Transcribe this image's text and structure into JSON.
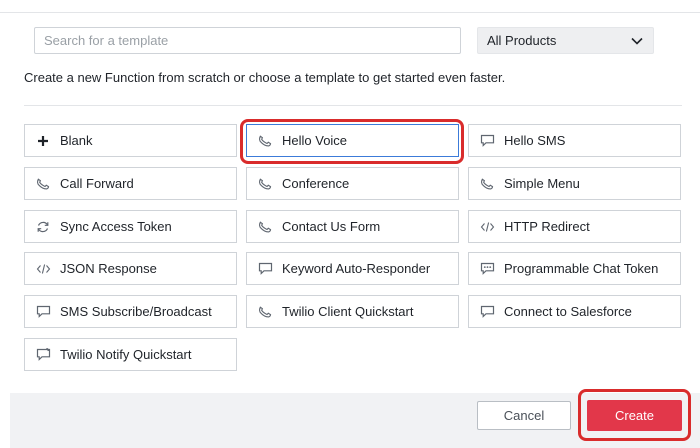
{
  "colors": {
    "accent": "#e2374a",
    "selection": "#3c7bd9",
    "highlight": "#d92c2c"
  },
  "search": {
    "placeholder": "Search for a template",
    "value": ""
  },
  "product_filter": {
    "selected": "All Products",
    "icon": "chevron-down-icon"
  },
  "intro_text": "Create a new Function from scratch or choose a template to get started even faster.",
  "templates": [
    {
      "label": "Blank",
      "icon": "plus-icon",
      "selected": false
    },
    {
      "label": "Hello Voice",
      "icon": "phone-icon",
      "selected": true
    },
    {
      "label": "Hello SMS",
      "icon": "message-icon",
      "selected": false
    },
    {
      "label": "Call Forward",
      "icon": "phone-icon",
      "selected": false
    },
    {
      "label": "Conference",
      "icon": "phone-icon",
      "selected": false
    },
    {
      "label": "Simple Menu",
      "icon": "phone-icon",
      "selected": false
    },
    {
      "label": "Sync Access Token",
      "icon": "sync-icon",
      "selected": false
    },
    {
      "label": "Contact Us Form",
      "icon": "phone-icon",
      "selected": false
    },
    {
      "label": "HTTP Redirect",
      "icon": "code-icon",
      "selected": false
    },
    {
      "label": "JSON Response",
      "icon": "code-icon",
      "selected": false
    },
    {
      "label": "Keyword Auto-Responder",
      "icon": "message-icon",
      "selected": false
    },
    {
      "label": "Programmable Chat Token",
      "icon": "chat-icon",
      "selected": false
    },
    {
      "label": "SMS Subscribe/Broadcast",
      "icon": "message-icon",
      "selected": false
    },
    {
      "label": "Twilio Client Quickstart",
      "icon": "phone-icon",
      "selected": false
    },
    {
      "label": "Connect to Salesforce",
      "icon": "message-icon",
      "selected": false
    },
    {
      "label": "Twilio Notify Quickstart",
      "icon": "notify-icon",
      "selected": false
    }
  ],
  "footer": {
    "cancel_label": "Cancel",
    "create_label": "Create"
  }
}
